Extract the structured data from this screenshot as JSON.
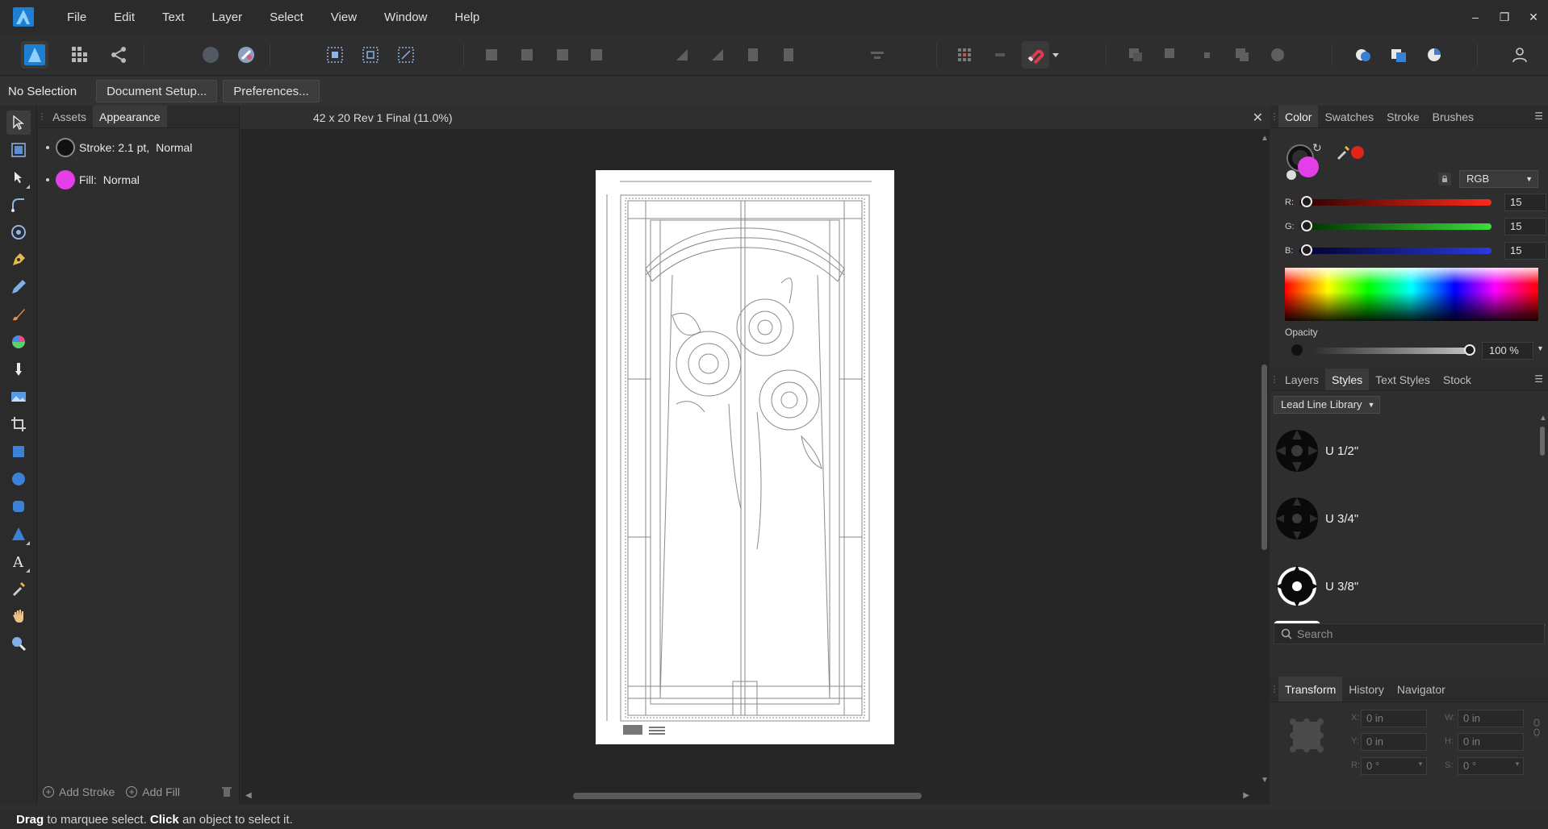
{
  "menubar": {
    "items": [
      "File",
      "Edit",
      "Text",
      "Layer",
      "Select",
      "View",
      "Window",
      "Help"
    ],
    "window_controls": [
      "minimize-icon",
      "restore-icon",
      "close-icon"
    ]
  },
  "context": {
    "selection_label": "No Selection",
    "document_setup": "Document Setup...",
    "preferences": "Preferences..."
  },
  "left_panel": {
    "tabs": [
      "Assets",
      "Appearance"
    ],
    "active_tab": "Appearance",
    "stroke_label": "Stroke: 2.1 pt,",
    "stroke_mode": "Normal",
    "fill_label": "Fill:",
    "fill_mode": "Normal",
    "add_stroke": "Add Stroke",
    "add_fill": "Add Fill"
  },
  "document": {
    "title": "42 x 20 Rev 1 Final (11.0%)"
  },
  "color_panel": {
    "tabs": [
      "Color",
      "Swatches",
      "Stroke",
      "Brushes"
    ],
    "active_tab": "Color",
    "model": "RGB",
    "r_label": "R:",
    "r_value": "15",
    "g_label": "G:",
    "g_value": "15",
    "b_label": "B:",
    "b_value": "15",
    "opacity_label": "Opacity",
    "opacity_value": "100 %",
    "fill_color": "#e33ee8",
    "stroke_color": "#0f0f0f",
    "eyedropper_color": "#e0241c"
  },
  "styles_panel": {
    "tabs": [
      "Layers",
      "Styles",
      "Text Styles",
      "Stock"
    ],
    "active_tab": "Styles",
    "library": "Lead Line Library",
    "items": [
      {
        "name": "U 1/2\""
      },
      {
        "name": "U 3/4\""
      },
      {
        "name": "U 3/8\""
      }
    ],
    "search_placeholder": "Search"
  },
  "transform_panel": {
    "tabs": [
      "Transform",
      "History",
      "Navigator"
    ],
    "active_tab": "Transform",
    "x_label": "X:",
    "x_value": "0 in",
    "y_label": "Y:",
    "y_value": "0 in",
    "w_label": "W:",
    "w_value": "0 in",
    "h_label": "H:",
    "h_value": "0 in",
    "r_label": "R:",
    "r_value": "0 °",
    "s_label": "S:",
    "s_value": "0 °"
  },
  "status": {
    "drag": "Drag",
    "drag_text": " to marquee select. ",
    "click": "Click",
    "click_text": " an object to select it."
  }
}
